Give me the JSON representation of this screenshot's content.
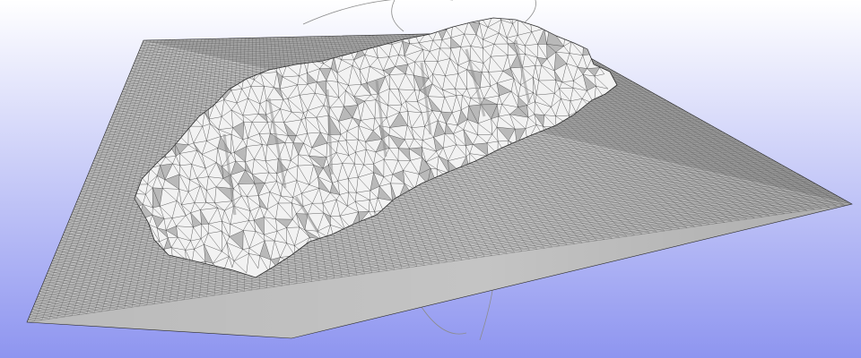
{
  "viewport": {
    "background_top": "#ffffff",
    "background_bottom": "#8e95f0",
    "mesh_face_color": "#c4c4c4",
    "mesh_face_shaded": "#a8a8a8",
    "mesh_edge_color": "#2a2a2a",
    "mountain_face_color": "#f2f2f2",
    "mountain_shadow_color": "#8a8a8a",
    "arcball_color": "#8c8c8c"
  }
}
